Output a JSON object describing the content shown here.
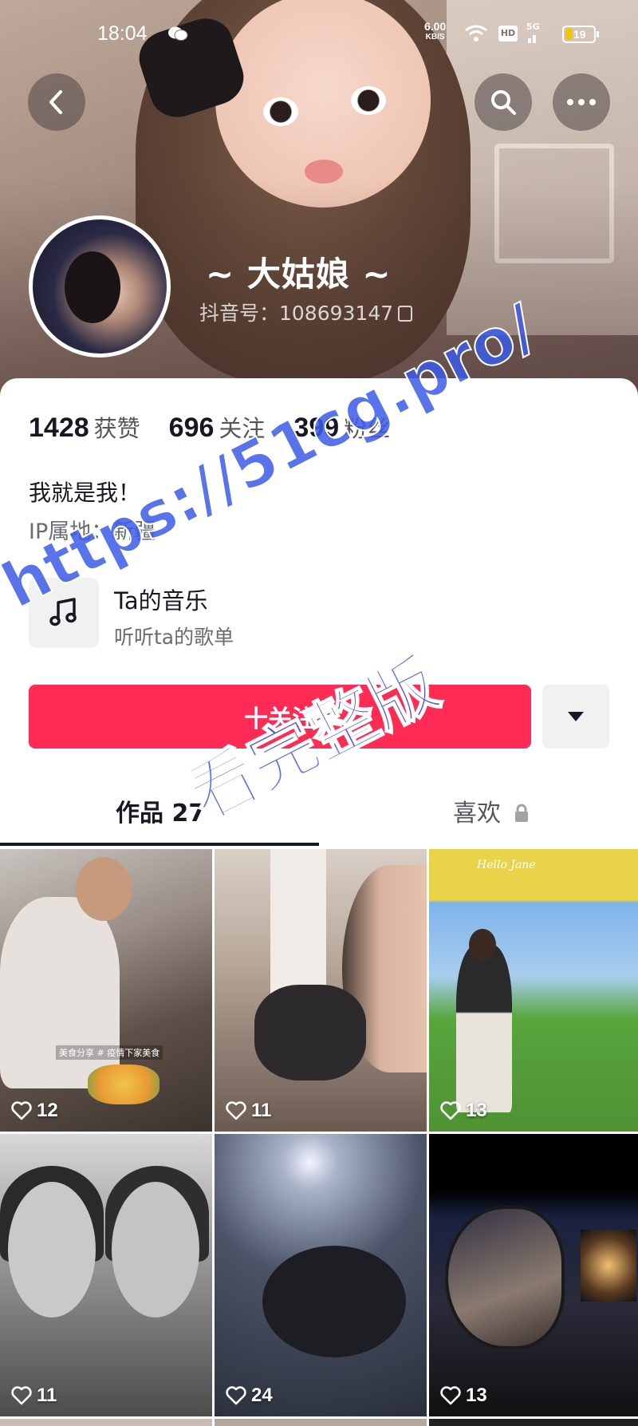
{
  "status_bar": {
    "time": "18:04",
    "net_speed": "6.00",
    "net_unit": "KB/S",
    "hd": "HD",
    "signal": "5G",
    "battery": "19"
  },
  "profile": {
    "nickname": "~ 大姑娘 ~",
    "douyin_id": "抖音号：108693147",
    "stats": [
      {
        "value": "1428",
        "label": "获赞"
      },
      {
        "value": "696",
        "label": "关注"
      },
      {
        "value": "399",
        "label": "粉丝"
      }
    ],
    "bio": "我就是我！",
    "ip_location": "IP属地：新疆"
  },
  "music": {
    "title": "Ta的音乐",
    "subtitle": "听听ta的歌单"
  },
  "actions": {
    "follow_label": "十关注"
  },
  "tabs": {
    "works": "作品 27",
    "likes": "喜欢"
  },
  "videos": [
    {
      "likes": "12",
      "caption": "美食分享 # 疫情下家美食"
    },
    {
      "likes": "11"
    },
    {
      "likes": "13",
      "sign": "Hello Jane"
    },
    {
      "likes": "11"
    },
    {
      "likes": "24"
    },
    {
      "likes": "13"
    }
  ],
  "watermark": {
    "line1": "https://51cg.pro/",
    "line2": "看完整版"
  },
  "colors": {
    "follow_button": "#fe2c55",
    "watermark": "#3c5ae6"
  }
}
